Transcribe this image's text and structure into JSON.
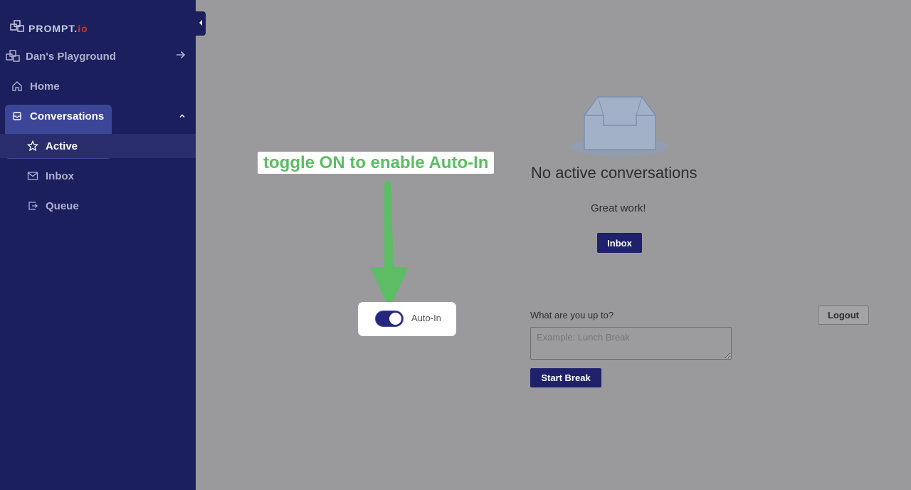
{
  "brand": {
    "name": "PROMPT.",
    "suffix": "io"
  },
  "sidebar": {
    "workspace": "Dan's Playground",
    "items": [
      {
        "label": "Home"
      },
      {
        "label": "Conversations"
      },
      {
        "label": "Active"
      },
      {
        "label": "Inbox"
      },
      {
        "label": "Queue"
      }
    ]
  },
  "main": {
    "empty_title": "No active conversations",
    "empty_subtitle": "Great work!",
    "inbox_button": "Inbox"
  },
  "break_form": {
    "label": "What are you up to?",
    "placeholder": "Example: Lunch Break",
    "start_button": "Start Break",
    "logout_button": "Logout"
  },
  "auto_in": {
    "label": "Auto-In",
    "enabled": true
  },
  "annotation": {
    "text": "toggle ON to enable Auto-In"
  },
  "colors": {
    "sidebar": "#1c1f5e",
    "accent": "#1f226a",
    "annotation": "#5cbd64"
  }
}
